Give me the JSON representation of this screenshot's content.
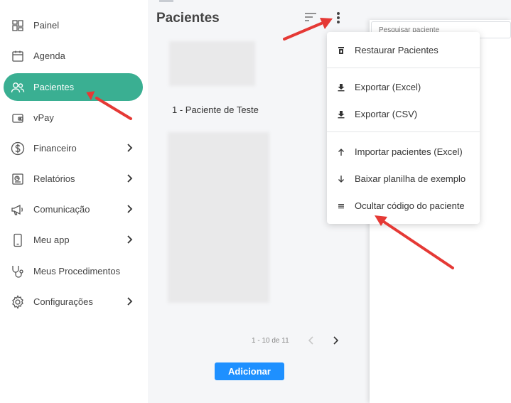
{
  "sidebar": {
    "items": [
      {
        "label": "Painel",
        "icon": "dashboard-icon",
        "has_chevron": false,
        "active": false
      },
      {
        "label": "Agenda",
        "icon": "calendar-icon",
        "has_chevron": false,
        "active": false
      },
      {
        "label": "Pacientes",
        "icon": "users-icon",
        "has_chevron": false,
        "active": true
      },
      {
        "label": "vPay",
        "icon": "wallet-icon",
        "has_chevron": false,
        "active": false
      },
      {
        "label": "Financeiro",
        "icon": "dollar-circle-icon",
        "has_chevron": true,
        "active": false
      },
      {
        "label": "Relatórios",
        "icon": "report-icon",
        "has_chevron": true,
        "active": false
      },
      {
        "label": "Comunicação",
        "icon": "megaphone-icon",
        "has_chevron": true,
        "active": false
      },
      {
        "label": "Meu app",
        "icon": "phone-icon",
        "has_chevron": true,
        "active": false
      },
      {
        "label": "Meus Procedimentos",
        "icon": "stethoscope-icon",
        "has_chevron": false,
        "active": false
      },
      {
        "label": "Configurações",
        "icon": "gear-icon",
        "has_chevron": true,
        "active": false
      }
    ],
    "active_color": "#3aaf92"
  },
  "main": {
    "title": "Pacientes",
    "patient_name": "1 - Paciente de Teste",
    "pagination": "1 - 10 de 11",
    "add_button": "Adicionar"
  },
  "panel": {
    "search_placeholder": "Pesquisar paciente"
  },
  "menu": {
    "items": [
      {
        "label": "Restaurar Pacientes",
        "icon": "restore-icon"
      },
      {
        "label": "Exportar (Excel)",
        "icon": "download-icon"
      },
      {
        "label": "Exportar (CSV)",
        "icon": "download-icon"
      },
      {
        "label": "Importar pacientes (Excel)",
        "icon": "arrow-up-icon"
      },
      {
        "label": "Baixar planilha de exemplo",
        "icon": "arrow-down-icon"
      },
      {
        "label": "Ocultar código do paciente",
        "icon": "list-icon"
      }
    ]
  },
  "colors": {
    "accent": "#3aaf92",
    "button": "#1e90ff",
    "annotation_arrow": "#e53935"
  }
}
